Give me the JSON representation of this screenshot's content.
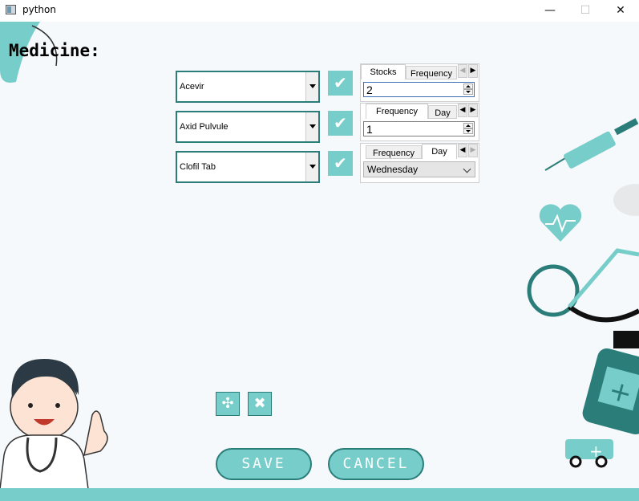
{
  "window": {
    "title": "python",
    "minimize_glyph": "—",
    "maximize_glyph": "☐",
    "close_glyph": "✕"
  },
  "heading": "Medicine:",
  "medicines": [
    {
      "name": "Acevir",
      "panel": {
        "tabs": [
          "Stocks",
          "Frequency"
        ],
        "active_tab": "Stocks",
        "value": "2"
      }
    },
    {
      "name": "Axid Pulvule",
      "panel": {
        "tabs": [
          "Frequency",
          "Day"
        ],
        "active_tab": "Frequency",
        "value": "1"
      }
    },
    {
      "name": "Clofil Tab",
      "panel": {
        "tabs": [
          "Frequency",
          "Day"
        ],
        "active_tab": "Day",
        "value": "Wednesday"
      }
    }
  ],
  "check_glyph": "✔",
  "add_glyph": "✣",
  "remove_glyph": "✖",
  "buttons": {
    "save": "SAVE",
    "cancel": "CANCEL"
  },
  "colors": {
    "accent": "#77cdc9",
    "border": "#2a7d78",
    "background": "#f5f9fc"
  }
}
